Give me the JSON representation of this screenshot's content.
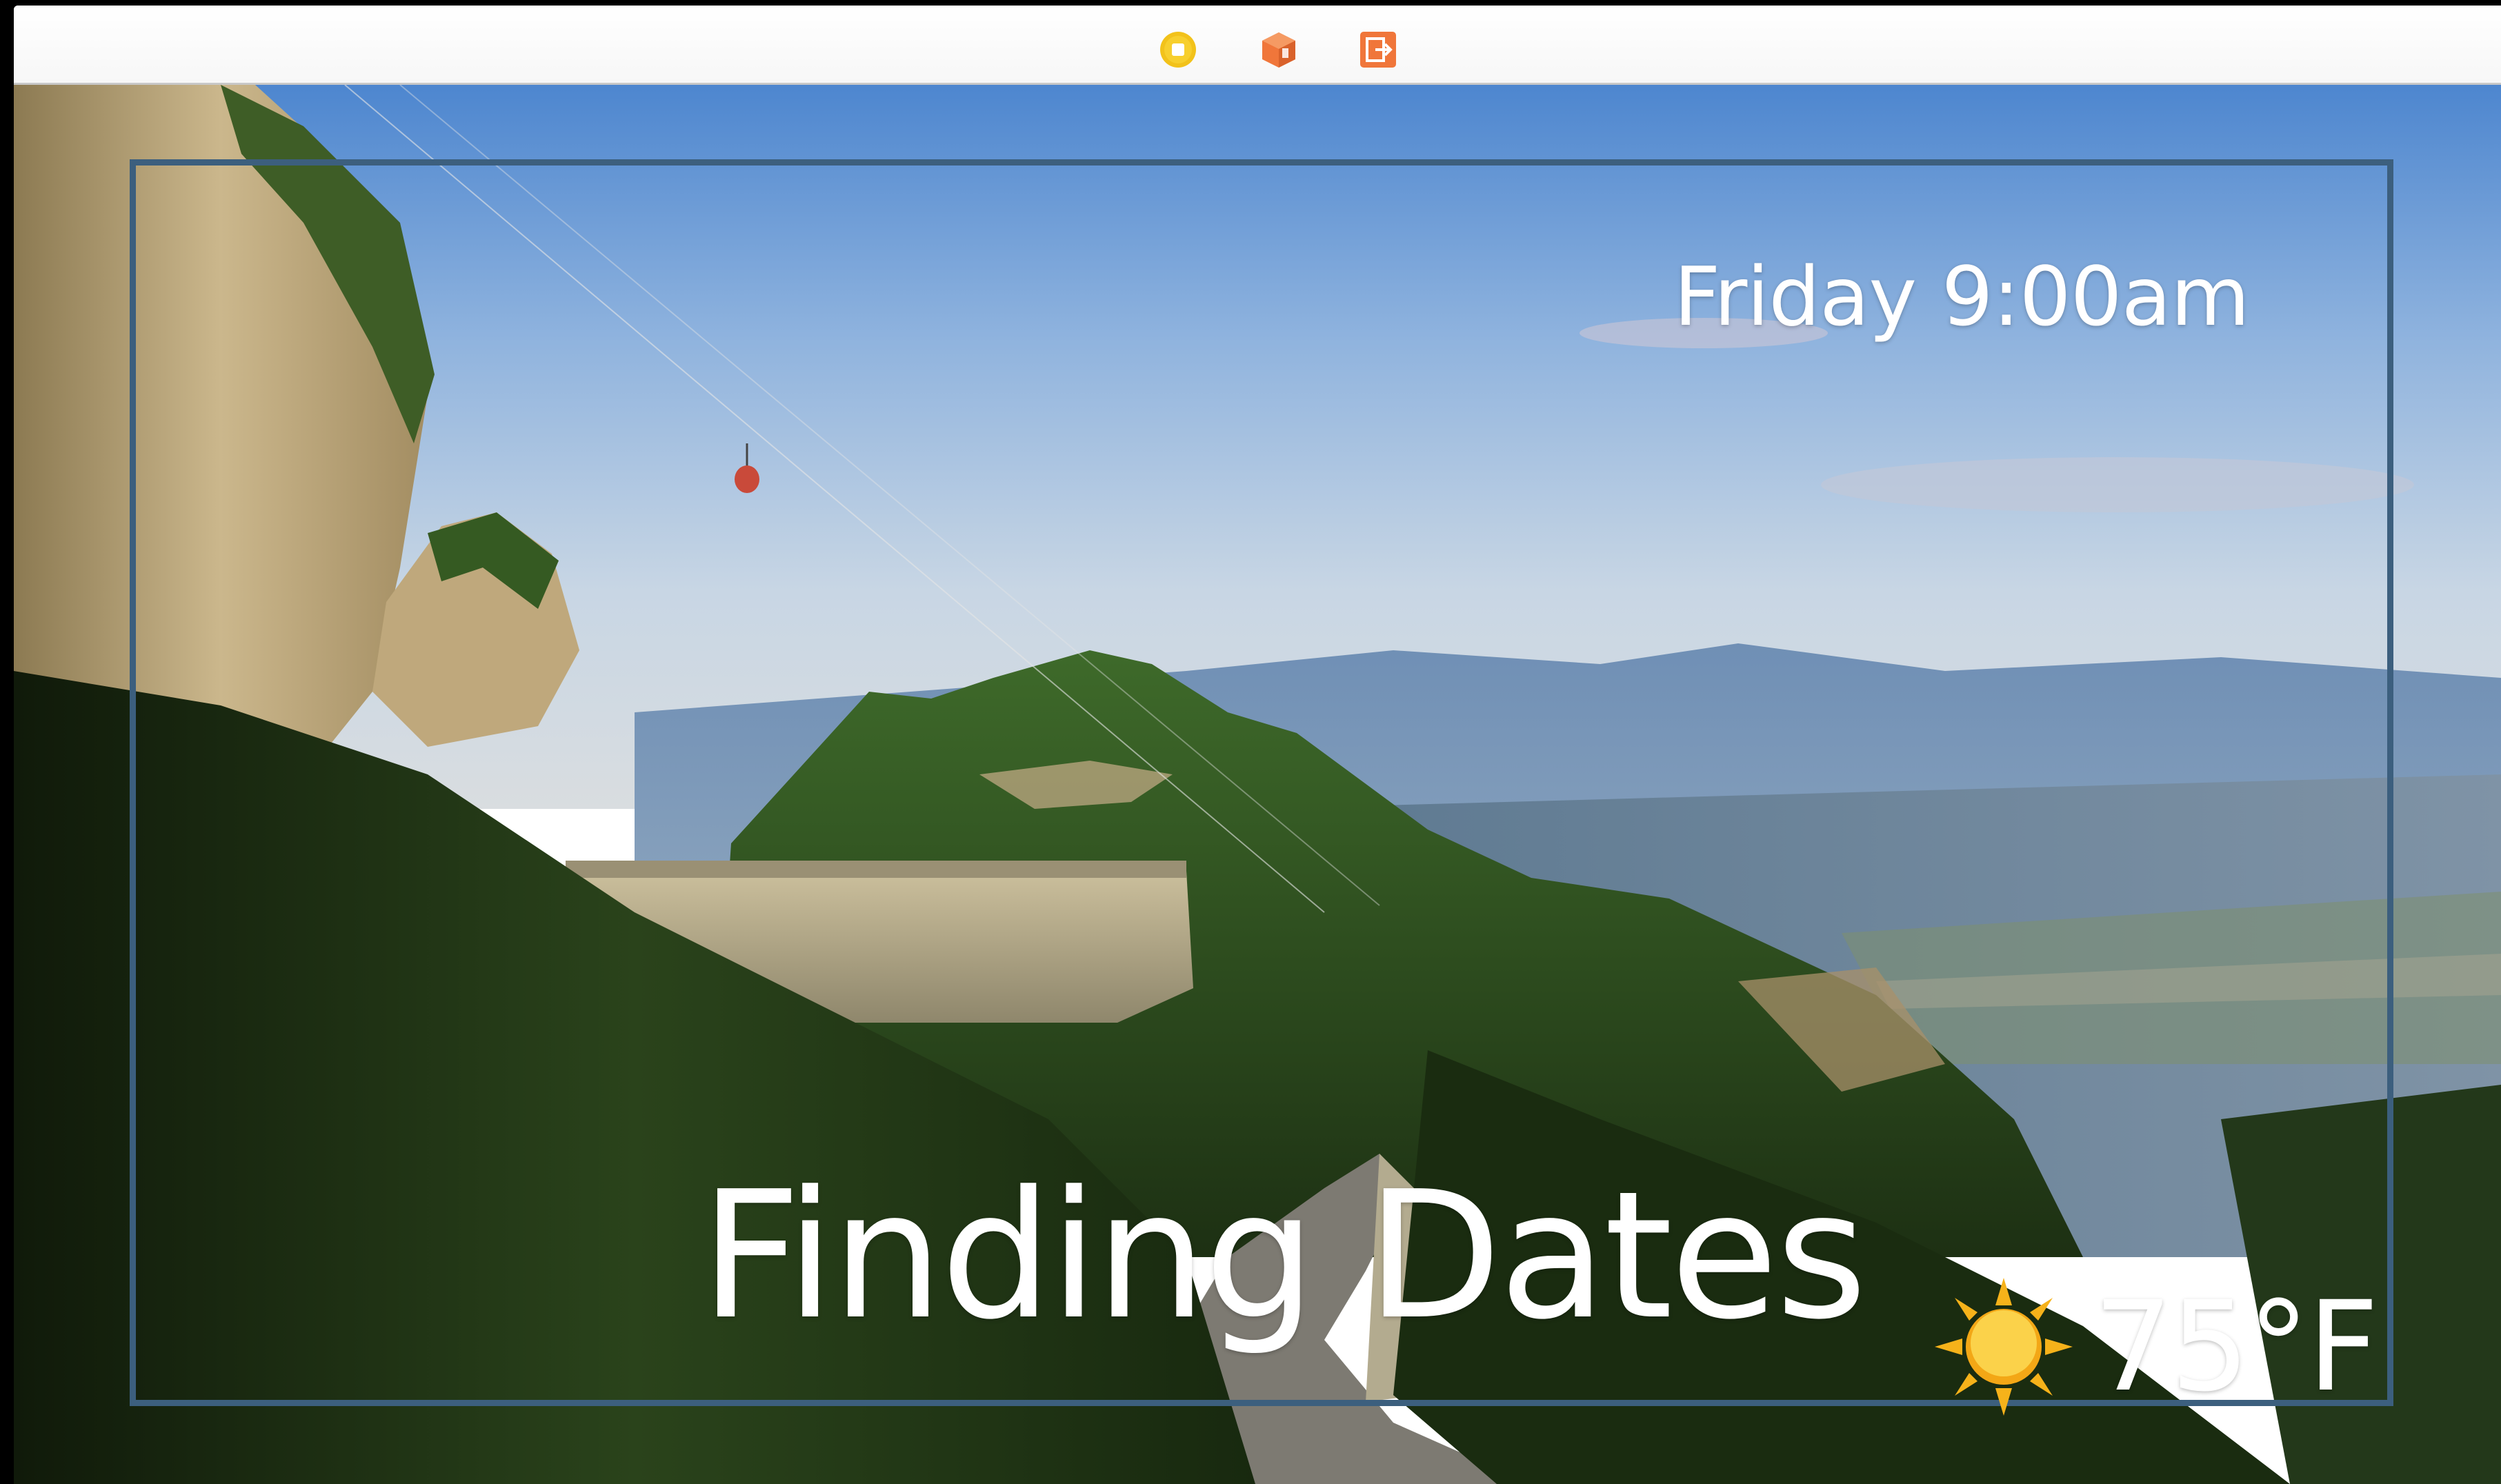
{
  "toolbar": {
    "icons": [
      {
        "name": "stop-icon",
        "color": "#f2c21a"
      },
      {
        "name": "cube-icon",
        "color": "#f0763a"
      },
      {
        "name": "exit-icon",
        "color": "#f0763a"
      }
    ]
  },
  "overlay": {
    "datetime": "Friday 9:00am",
    "title": "Finding Dates",
    "weather": {
      "icon": "sun-icon",
      "temperature": "75°F"
    },
    "frame_color": "#3c5f7e"
  },
  "background": {
    "description_icon": "landscape-photo"
  }
}
